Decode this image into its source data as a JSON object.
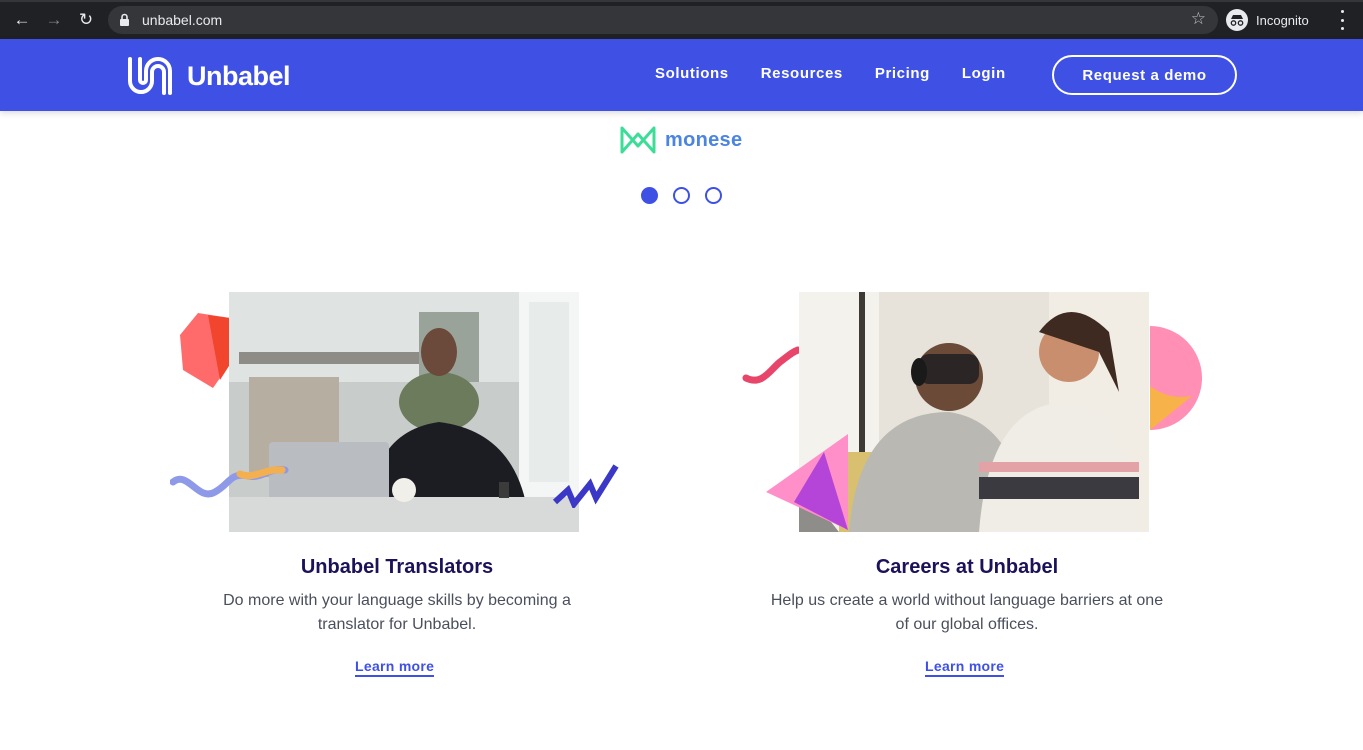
{
  "browser": {
    "url": "unbabel.com",
    "incognito_label": "Incognito"
  },
  "header": {
    "logo_text": "Unbabel",
    "nav": [
      "Solutions",
      "Resources",
      "Pricing",
      "Login"
    ],
    "cta": "Request a demo",
    "colors": {
      "brand": "#3f51e5"
    }
  },
  "carousel": {
    "logo_text": "monese",
    "dots": 3,
    "active_index": 0
  },
  "cards": [
    {
      "title": "Unbabel Translators",
      "description_line1": "Do more with your language skills by becoming a",
      "description_line2": "translator for Unbabel.",
      "link": "Learn more"
    },
    {
      "title": "Careers at Unbabel",
      "description_line1": "Help us create a world without language barriers at one",
      "description_line2": "of our global offices.",
      "link": "Learn more"
    }
  ]
}
